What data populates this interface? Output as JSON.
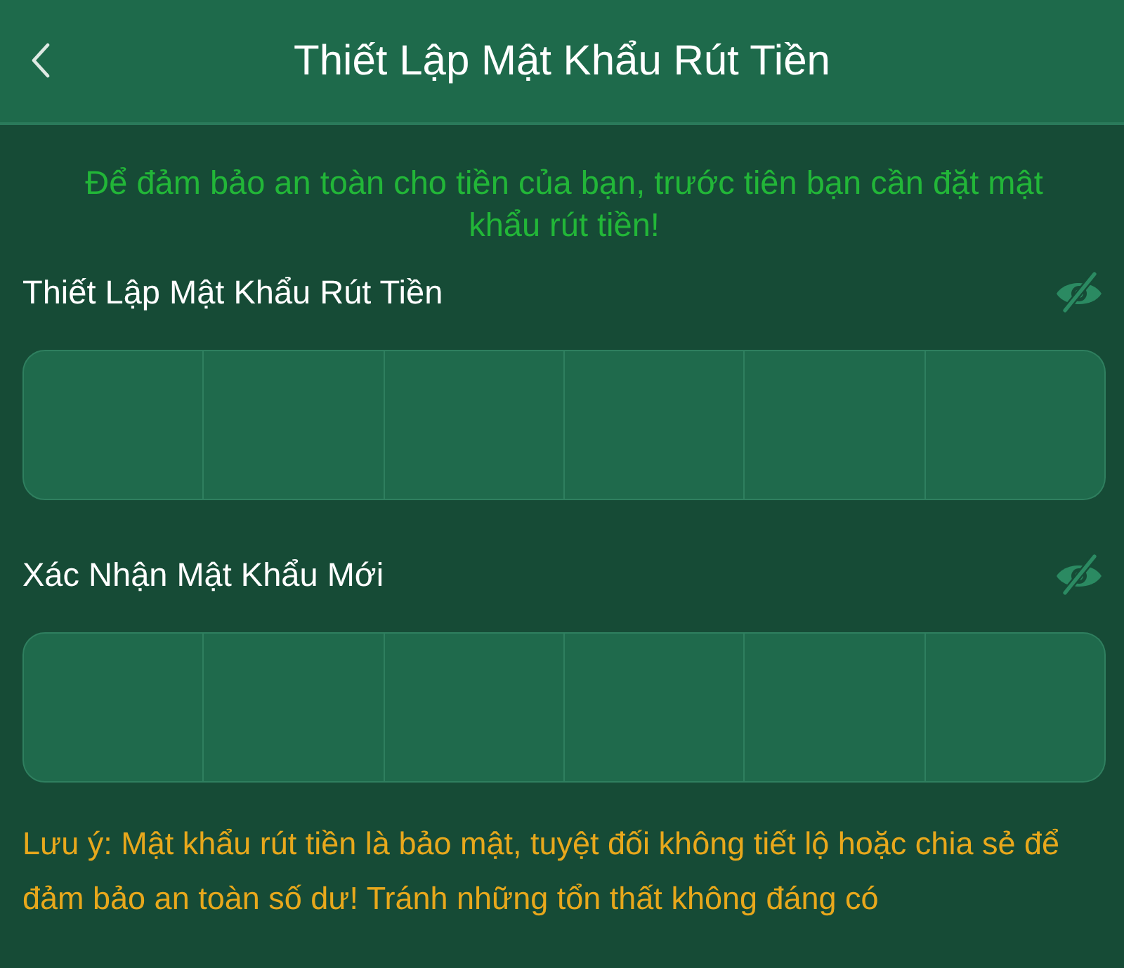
{
  "header": {
    "title": "Thiết Lập Mật Khẩu Rút Tiền"
  },
  "intro": "Để đảm bảo an toàn cho tiền của bạn, trước tiên bạn cần đặt mật khẩu rút tiền!",
  "password_fields": [
    {
      "label": "Thiết Lập Mật Khẩu Rút Tiền",
      "visible": false,
      "digits": [
        {
          "filled": false
        },
        {
          "filled": false
        },
        {
          "filled": false
        },
        {
          "filled": false
        },
        {
          "filled": false
        },
        {
          "filled": false
        }
      ]
    },
    {
      "label": "Xác Nhận Mật Khẩu Mới",
      "visible": false,
      "digits": [
        {
          "filled": false
        },
        {
          "filled": false
        },
        {
          "filled": false
        },
        {
          "filled": false
        },
        {
          "filled": false
        },
        {
          "filled": false
        }
      ]
    }
  ],
  "note": "Lưu ý: Mật khẩu rút tiền là bảo mật, tuyệt đối không tiết lộ hoặc chia sẻ để đảm bảo an toàn số dư! Tránh những tổn thất không đáng có"
}
